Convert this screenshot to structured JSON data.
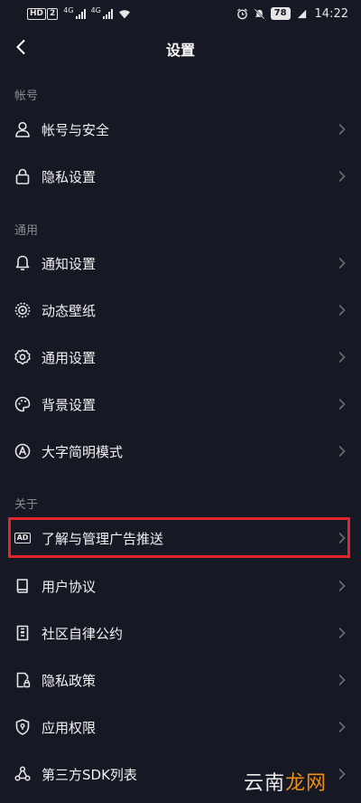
{
  "status_bar": {
    "hd_badge": "HD",
    "sim_badge": "2",
    "network_1": "4G",
    "network_2": "4G",
    "battery": "78",
    "time": "14:22"
  },
  "header": {
    "title": "设置"
  },
  "sections": {
    "account": {
      "title": "帐号",
      "items": [
        {
          "label": "帐号与安全",
          "icon": "person-icon"
        },
        {
          "label": "隐私设置",
          "icon": "lock-icon"
        }
      ]
    },
    "general": {
      "title": "通用",
      "items": [
        {
          "label": "通知设置",
          "icon": "bell-icon"
        },
        {
          "label": "动态壁纸",
          "icon": "wallpaper-icon"
        },
        {
          "label": "通用设置",
          "icon": "gear-icon"
        },
        {
          "label": "背景设置",
          "icon": "palette-icon"
        },
        {
          "label": "大字简明模式",
          "icon": "text-size-icon"
        }
      ]
    },
    "about": {
      "title": "关于",
      "items": [
        {
          "label": "了解与管理广告推送",
          "icon": "ad-icon",
          "badge": "AD"
        },
        {
          "label": "用户协议",
          "icon": "book-icon"
        },
        {
          "label": "社区自律公约",
          "icon": "community-icon"
        },
        {
          "label": "隐私政策",
          "icon": "privacy-doc-icon"
        },
        {
          "label": "应用权限",
          "icon": "shield-icon"
        },
        {
          "label": "第三方SDK列表",
          "icon": "share-nodes-icon"
        }
      ]
    }
  },
  "highlight_color": "#e0242b",
  "background_color": "#161823",
  "watermark": {
    "part1": "云南",
    "part2": "龙网"
  }
}
